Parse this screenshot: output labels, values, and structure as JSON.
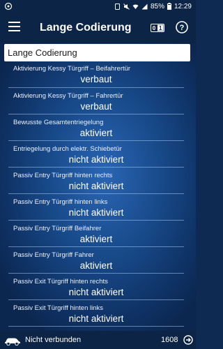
{
  "statusbar": {
    "battery": "85%",
    "time": "12:29",
    "icons": [
      "notification-icon",
      "sim-icon",
      "mute-icon",
      "wifi-icon",
      "signal-icon",
      "battery-icon"
    ]
  },
  "toolbar": {
    "title": "Lange Codierung",
    "toggle_label": "01",
    "icons": [
      "menu-icon",
      "binary-toggle-icon",
      "help-icon"
    ]
  },
  "section_header": "Lange Codierung",
  "items": [
    {
      "label": "Aktivierung Kessy Türgriff – Beifahrertür",
      "value": "verbaut"
    },
    {
      "label": "Aktivierung Kessy Türgriff – Fahrertür",
      "value": "verbaut"
    },
    {
      "label": "Bewusste Gesamtentriegelung",
      "value": "aktiviert"
    },
    {
      "label": "Entriegelung durch elektr. Schiebetür",
      "value": "nicht aktiviert"
    },
    {
      "label": "Passiv Entry Türgriff hinten rechts",
      "value": "nicht aktiviert"
    },
    {
      "label": "Passiv Entry Türgriff hinten links",
      "value": "nicht aktiviert"
    },
    {
      "label": "Passiv Entry Türgriff Beifahrer",
      "value": "aktiviert"
    },
    {
      "label": "Passiv Entry Türgriff Fahrer",
      "value": "aktiviert"
    },
    {
      "label": "Passiv Exit Türgriff hinten rechts",
      "value": "nicht aktiviert"
    },
    {
      "label": "Passiv Exit Türgriff hinten links",
      "value": "nicht aktiviert"
    }
  ],
  "bottombar": {
    "connection_status": "Nicht verbunden",
    "counter": "1608",
    "icons": [
      "car-icon",
      "exit-icon"
    ]
  },
  "colors": {
    "bar_background": "#0c2446",
    "background_center": "#2a66b4",
    "background_edge": "#0b2750",
    "header_background": "#ffffff",
    "text": "#ffffff"
  }
}
